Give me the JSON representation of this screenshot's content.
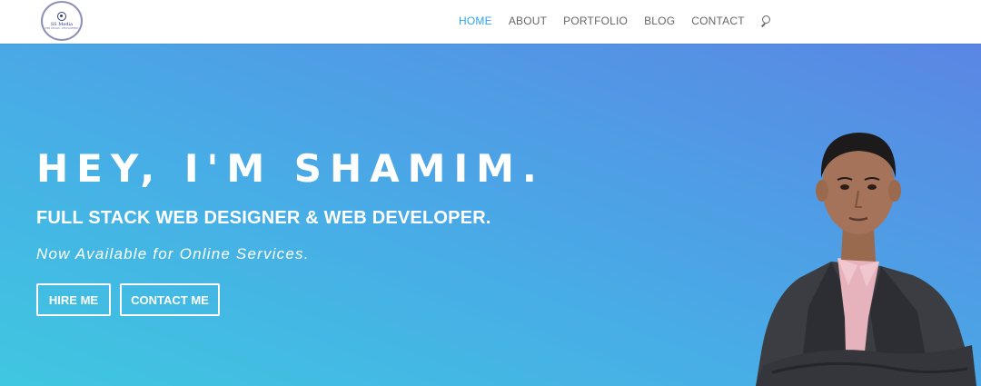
{
  "header": {
    "logo": {
      "title": "SS Media",
      "subtitle": "WEB DESIGN · DEVELOPMENT"
    },
    "nav": [
      {
        "label": "HOME",
        "active": true
      },
      {
        "label": "ABOUT",
        "active": false
      },
      {
        "label": "PORTFOLIO",
        "active": false
      },
      {
        "label": "BLOG",
        "active": false
      },
      {
        "label": "CONTACT",
        "active": false
      }
    ],
    "search_icon": "search-icon"
  },
  "hero": {
    "title": "HEY, I'M SHAMIM.",
    "subtitle": "FULL STACK WEB DESIGNER & WEB DEVELOPER.",
    "tagline": "Now Available for Online Services.",
    "buttons": {
      "hire": "HIRE ME",
      "contact": "CONTACT ME"
    },
    "portrait": "person in dark suit with pink shirt, arms crossed"
  },
  "colors": {
    "accent": "#2ea3f2",
    "nav_text": "#666666",
    "gradient_start": "#3fc7e0",
    "gradient_end": "#5a86e4",
    "hero_text": "#ffffff"
  }
}
